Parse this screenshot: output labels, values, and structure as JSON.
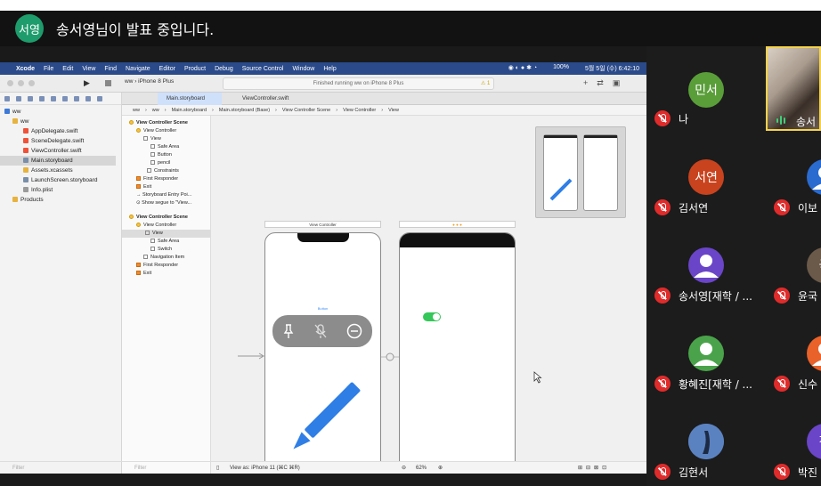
{
  "zoom_meeting": {
    "presenter_avatar": "서영",
    "presenter_text": "송서영님이 발표 중입니다."
  },
  "mac_menu": {
    "app": "Xcode",
    "items": [
      "File",
      "Edit",
      "View",
      "Find",
      "Navigate",
      "Editor",
      "Product",
      "Debug",
      "Source Control",
      "Window",
      "Help"
    ],
    "battery": "100%",
    "datetime": "5월 5일 (수)  6:42:10"
  },
  "xcode": {
    "scheme": "ww  ›  iPhone 8 Plus",
    "activity": "Finished running ww on iPhone 8 Plus",
    "warning_count": "1",
    "tabs": [
      "Main.storyboard",
      "ViewController.swift"
    ],
    "jumpbar": [
      "ww",
      "ww",
      "Main.storyboard",
      "Main.storyboard (Base)",
      "View Controller Scene",
      "View Controller",
      "View"
    ],
    "navigator": {
      "items": [
        {
          "label": "ww",
          "icon": "project-icon"
        },
        {
          "label": "ww",
          "icon": "folder-icon"
        },
        {
          "label": "AppDelegate.swift",
          "icon": "swift-icon"
        },
        {
          "label": "SceneDelegate.swift",
          "icon": "swift-icon"
        },
        {
          "label": "ViewController.swift",
          "icon": "swift-icon"
        },
        {
          "label": "Main.storyboard",
          "icon": "storyboard-icon"
        },
        {
          "label": "Assets.xcassets",
          "icon": "folder-icon"
        },
        {
          "label": "LaunchScreen.storyboard",
          "icon": "storyboard-icon"
        },
        {
          "label": "Info.plist",
          "icon": "plist-icon"
        },
        {
          "label": "Products",
          "icon": "folder-icon"
        }
      ],
      "filter_placeholder": "Filter"
    },
    "outline": {
      "scene1": [
        "View Controller Scene",
        "View Controller",
        "View",
        "Safe Area",
        "Button",
        "pencil",
        "Constraints",
        "First Responder",
        "Exit",
        "Storyboard Entry Poi...",
        "Show segue to \"View..."
      ],
      "scene2": [
        "View Controller Scene",
        "View Controller",
        "View",
        "Safe Area",
        "Switch",
        "Navigation Item",
        "First Responder",
        "Exit"
      ],
      "filter_placeholder": "Filter"
    },
    "canvas": {
      "vc_label": "View Controller",
      "button_label": "Button"
    },
    "bottom": {
      "view_as": "View as: iPhone 11 (⌘C  ⌘R)",
      "zoom": "62%"
    }
  },
  "participants": [
    {
      "avatar": "민서",
      "name": "나",
      "color": "#5a9e3a"
    },
    {
      "avatar": "",
      "name": "송서",
      "color": ""
    },
    {
      "avatar": "서연",
      "name": "김서연",
      "color": "#c8431e"
    },
    {
      "avatar": "",
      "name": "이보",
      "color": "#2a6bd0"
    },
    {
      "avatar": "",
      "name": "송서영[재학 / ...",
      "color": "#6a45c8"
    },
    {
      "avatar": "국",
      "name": "윤국",
      "color": "#6b5a4a"
    },
    {
      "avatar": "",
      "name": "황혜진[재학 / ...",
      "color": "#4aa34a"
    },
    {
      "avatar": "",
      "name": "신수",
      "color": "#e8622a"
    },
    {
      "avatar": "",
      "name": "김현서",
      "color": "#5b82c0"
    },
    {
      "avatar": "진",
      "name": "박진",
      "color": "#6a45c8"
    }
  ]
}
